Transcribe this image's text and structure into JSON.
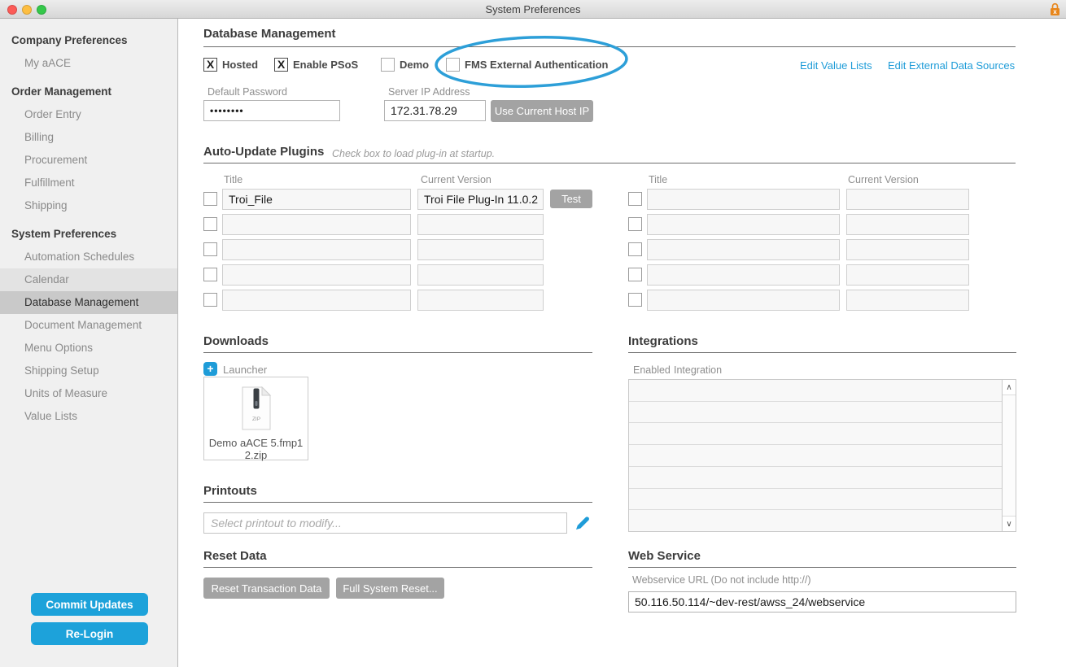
{
  "colors": {
    "accent_blue": "#1e9cd8",
    "button_gray": "#a3a3a3",
    "lock_orange": "#e8861b",
    "sidebar_selected": "#c9c9c9"
  },
  "window": {
    "title": "System Preferences"
  },
  "sidebar": {
    "sections": [
      {
        "header": "Company Preferences",
        "items": [
          {
            "label": "My aACE"
          }
        ]
      },
      {
        "header": "Order Management",
        "items": [
          {
            "label": "Order Entry"
          },
          {
            "label": "Billing"
          },
          {
            "label": "Procurement"
          },
          {
            "label": "Fulfillment"
          },
          {
            "label": "Shipping"
          }
        ]
      },
      {
        "header": "System Preferences",
        "items": [
          {
            "label": "Automation Schedules"
          },
          {
            "label": "Calendar"
          },
          {
            "label": "Database Management",
            "selected": true
          },
          {
            "label": "Document Management"
          },
          {
            "label": "Menu Options"
          },
          {
            "label": "Shipping Setup"
          },
          {
            "label": "Units of Measure"
          },
          {
            "label": "Value Lists"
          }
        ]
      }
    ],
    "buttons": [
      {
        "label": "Commit Updates"
      },
      {
        "label": "Re-Login"
      }
    ]
  },
  "main": {
    "database_management": {
      "heading": "Database Management",
      "checkboxes": [
        {
          "label": "Hosted",
          "checked": true,
          "mark": "X"
        },
        {
          "label": "Enable PSoS",
          "checked": true,
          "mark": "X"
        },
        {
          "label": "Demo",
          "checked": false,
          "mark": ""
        },
        {
          "label": "FMS External Authentication",
          "checked": false,
          "mark": ""
        }
      ],
      "links": [
        {
          "label": "Edit Value Lists"
        },
        {
          "label": "Edit External Data Sources"
        }
      ],
      "default_password": {
        "label": "Default Password",
        "value": "••••••••"
      },
      "server_ip": {
        "label": "Server IP Address",
        "value": "172.31.78.29",
        "button": "Use Current Host IP"
      }
    },
    "plugins": {
      "heading": "Auto-Update Plugins",
      "note": "Check box to load plug-in at startup.",
      "col_title": "Title",
      "col_version": "Current Version",
      "left_rows": [
        {
          "title": "Troi_File",
          "version": "Troi File Plug-In 11.0.2",
          "test": "Test"
        },
        {
          "title": "",
          "version": ""
        },
        {
          "title": "",
          "version": ""
        },
        {
          "title": "",
          "version": ""
        },
        {
          "title": "",
          "version": ""
        }
      ],
      "right_rows": [
        {
          "title": "",
          "version": ""
        },
        {
          "title": "",
          "version": ""
        },
        {
          "title": "",
          "version": ""
        },
        {
          "title": "",
          "version": ""
        },
        {
          "title": "",
          "version": ""
        }
      ]
    },
    "downloads": {
      "heading": "Downloads",
      "launcher": "Launcher",
      "plus": "+",
      "file_name": "Demo aACE 5.fmp12.zip",
      "zip_label": "ZIP"
    },
    "integrations": {
      "heading": "Integrations",
      "col_enabled": "Enabled",
      "col_integration": "Integration",
      "scroll_up": "∧",
      "scroll_down": "∨"
    },
    "printouts": {
      "heading": "Printouts",
      "placeholder": "Select printout to modify..."
    },
    "reset": {
      "heading": "Reset Data",
      "buttons": [
        {
          "label": "Reset Transaction Data"
        },
        {
          "label": "Full System Reset..."
        }
      ]
    },
    "web_service": {
      "heading": "Web Service",
      "label": "Webservice URL (Do not include http://)",
      "url": "50.116.50.114/~dev-rest/awss_24/webservice"
    }
  }
}
